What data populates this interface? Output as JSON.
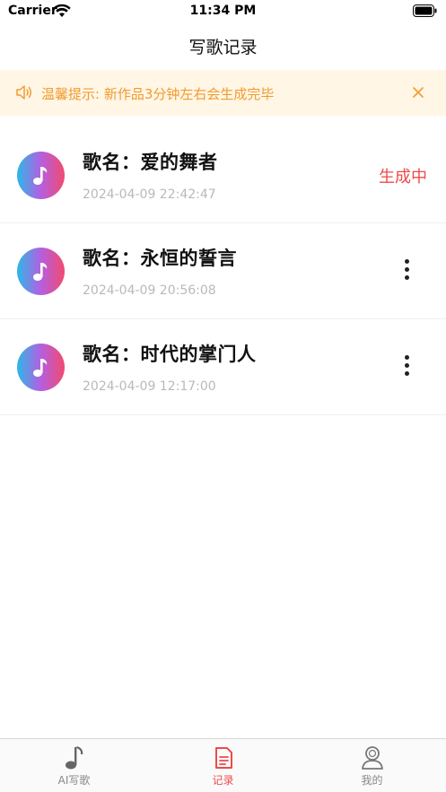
{
  "status_bar": {
    "carrier": "Carrier",
    "time": "11:34 PM"
  },
  "nav": {
    "title": "写歌记录"
  },
  "notice": {
    "text": "温馨提示: 新作品3分钟左右会生成完毕",
    "icon": "speaker-icon",
    "close_icon": "close-icon"
  },
  "songs": [
    {
      "title": "歌名：爱的舞者",
      "time": "2024-04-09 22:42:47",
      "status": "生成中"
    },
    {
      "title": "歌名：永恒的誓言",
      "time": "2024-04-09 20:56:08",
      "status": ""
    },
    {
      "title": "歌名：时代的掌门人",
      "time": "2024-04-09 12:17:00",
      "status": ""
    }
  ],
  "tabs": [
    {
      "label": "AI写歌",
      "icon": "music-note-icon",
      "active": false
    },
    {
      "label": "记录",
      "icon": "document-icon",
      "active": true
    },
    {
      "label": "我的",
      "icon": "user-icon",
      "active": false
    }
  ],
  "colors": {
    "accent": "#ef4a4a",
    "notice_bg": "#fff6e6",
    "notice_text": "#f29b2e"
  }
}
